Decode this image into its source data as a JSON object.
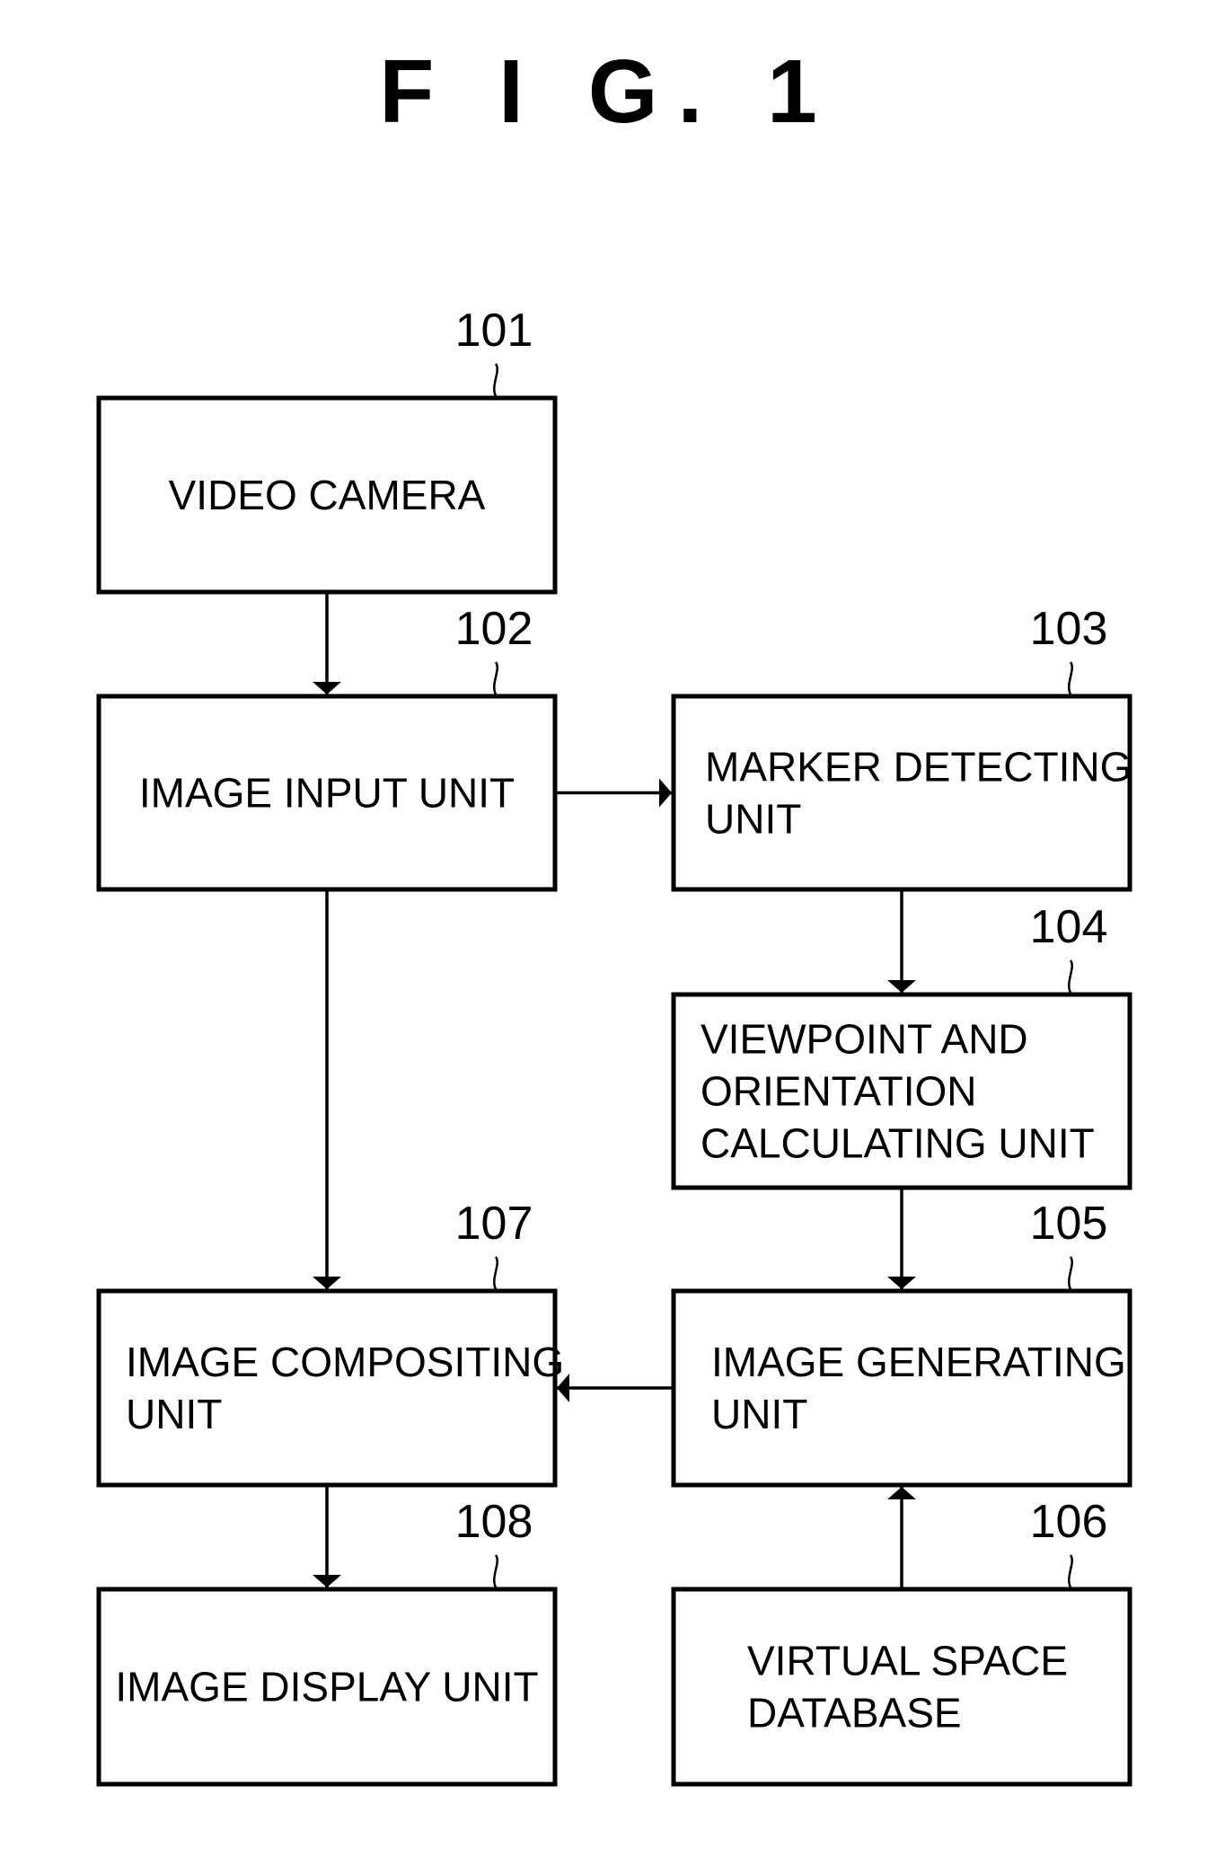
{
  "figure": {
    "title": "F I G.  1"
  },
  "blocks": [
    {
      "id": "101",
      "ref": "101",
      "lines": [
        "VIDEO CAMERA"
      ]
    },
    {
      "id": "102",
      "ref": "102",
      "lines": [
        "IMAGE INPUT UNIT"
      ]
    },
    {
      "id": "103",
      "ref": "103",
      "lines": [
        "MARKER DETECTING",
        "UNIT"
      ]
    },
    {
      "id": "104",
      "ref": "104",
      "lines": [
        "VIEWPOINT AND",
        "ORIENTATION",
        "CALCULATING UNIT"
      ]
    },
    {
      "id": "105",
      "ref": "105",
      "lines": [
        "IMAGE GENERATING",
        "UNIT"
      ]
    },
    {
      "id": "106",
      "ref": "106",
      "lines": [
        "VIRTUAL SPACE",
        "DATABASE"
      ]
    },
    {
      "id": "107",
      "ref": "107",
      "lines": [
        "IMAGE COMPOSITING",
        "UNIT"
      ]
    },
    {
      "id": "108",
      "ref": "108",
      "lines": [
        "IMAGE DISPLAY UNIT"
      ]
    }
  ],
  "connections": [
    {
      "from": "101",
      "to": "102"
    },
    {
      "from": "102",
      "to": "103"
    },
    {
      "from": "102",
      "to": "107"
    },
    {
      "from": "103",
      "to": "104"
    },
    {
      "from": "104",
      "to": "105"
    },
    {
      "from": "105",
      "to": "107"
    },
    {
      "from": "106",
      "to": "105"
    },
    {
      "from": "107",
      "to": "108"
    }
  ]
}
